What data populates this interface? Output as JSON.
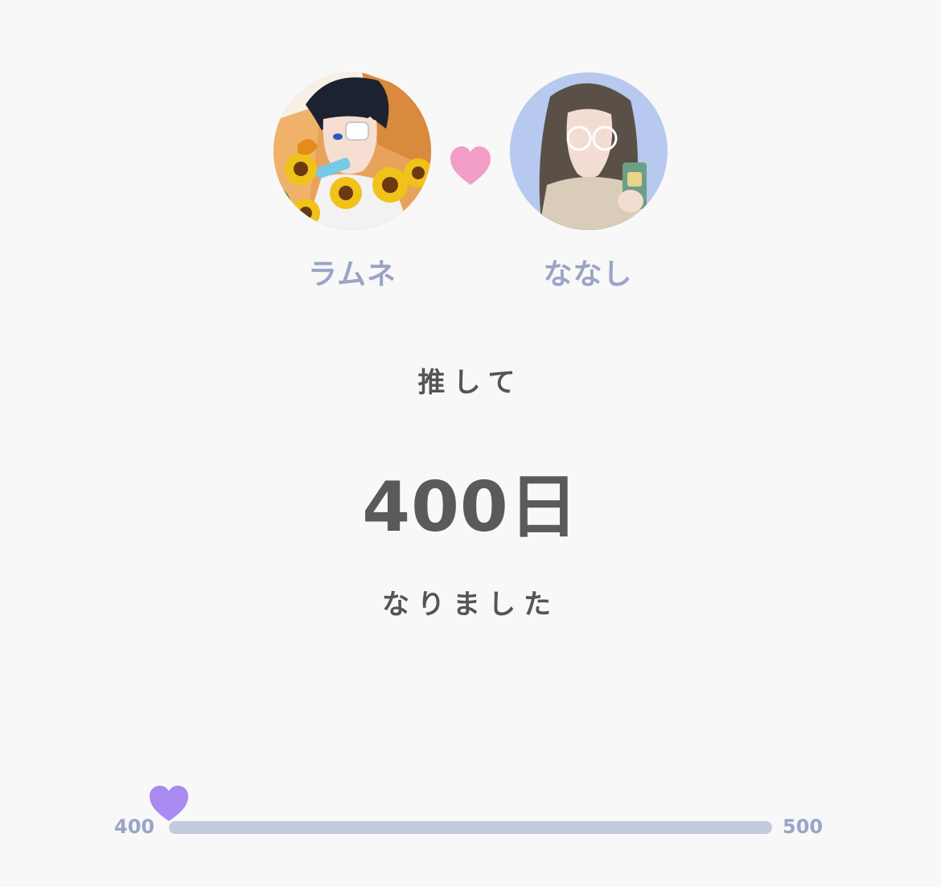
{
  "left_person": {
    "name": "ラムネ",
    "avatar": "anime-boy-with-sunflowers-avatar"
  },
  "right_person": {
    "name": "ななし",
    "avatar": "girl-with-drink-avatar"
  },
  "connector_icon": "heart-icon",
  "caption_top": "推して",
  "days_count": "400日",
  "caption_bottom": "なりました",
  "progress": {
    "min_label": "400",
    "max_label": "500",
    "value": 400,
    "min": 400,
    "max": 500,
    "marker_icon": "heart-icon"
  },
  "colors": {
    "background": "#f8f8f8",
    "heart_pink": "#f29dc6",
    "marker_purple": "#a98af2",
    "track": "#c2cbdc",
    "name_text": "#9aa4c6",
    "main_text": "#555555",
    "right_avatar_bg": "#b7c9ee"
  }
}
